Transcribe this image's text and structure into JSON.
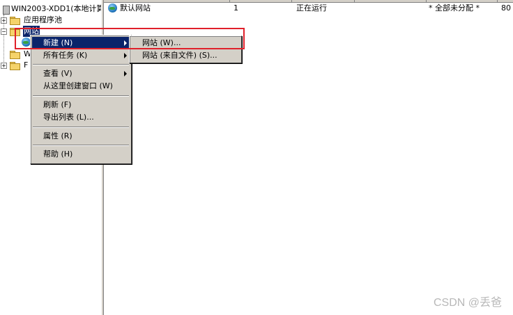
{
  "tree": {
    "server_label": "WIN2003-XDD1(本地计算",
    "items": [
      {
        "label": "应用程序池"
      },
      {
        "label": "网站"
      },
      {
        "label": "W"
      },
      {
        "label": "F"
      }
    ]
  },
  "list": {
    "rows": [
      {
        "name": "默认网站",
        "id": "1",
        "status": "正在运行",
        "ip": "* 全部未分配 *",
        "port": "80"
      }
    ]
  },
  "context_menu": {
    "items": [
      {
        "label": "新建 (N)",
        "has_submenu": true
      },
      {
        "label": "所有任务 (K)",
        "has_submenu": true
      },
      {
        "label": "查看 (V)",
        "has_submenu": true
      },
      {
        "label": "从这里创建窗口 (W)"
      },
      {
        "label": "刷新 (F)"
      },
      {
        "label": "导出列表 (L)..."
      },
      {
        "label": "属性 (R)"
      },
      {
        "label": "帮助 (H)"
      }
    ]
  },
  "submenu": {
    "items": [
      {
        "label": "网站 (W)..."
      },
      {
        "label": "网站 (来自文件) (S)..."
      }
    ]
  },
  "watermark": "CSDN @丢爸",
  "colors": {
    "highlight": "#0a246a",
    "annotation_red": "#e0202a",
    "menu_bg": "#d4d0c8"
  }
}
